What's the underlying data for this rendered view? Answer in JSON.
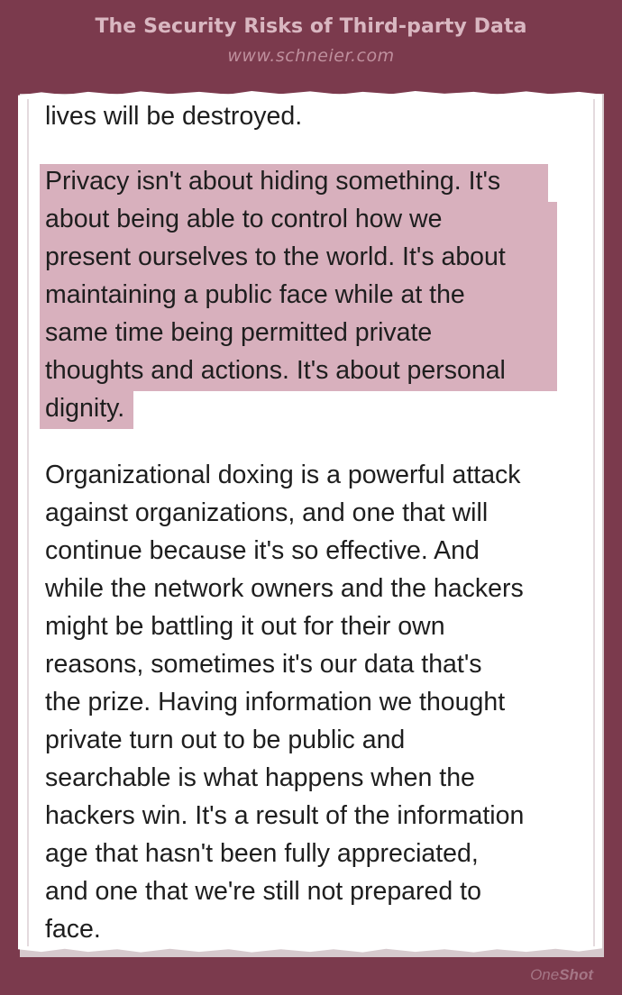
{
  "header": {
    "title": "The Security Risks of Third-party Data",
    "source": "www.schneier.com"
  },
  "article": {
    "lead_fragment": "lives will be destroyed.",
    "highlighted_lines": [
      "Privacy isn't about hiding something. It's",
      "about being able to control how we",
      "present ourselves to the world. It's about",
      "maintaining a public face while at the",
      "same time being permitted private",
      "thoughts and actions. It's about personal",
      "dignity."
    ],
    "paragraph_lines": [
      "Organizational doxing is a powerful attack",
      "against organizations, and one that will",
      "continue because it's so effective. And",
      "while the network owners and the hackers",
      "might be battling it out for their own",
      "reasons, sometimes it's our data that's",
      "the prize. Having information we thought",
      "private turn out to be public and",
      "searchable is what happens when the",
      "hackers win. It's a result of the information",
      "age that hasn't been fully appreciated,",
      "and one that we're still not prepared to",
      "face."
    ],
    "highlight_color": "#d8b0bd"
  },
  "footer": {
    "brand_light": "One",
    "brand_bold": "Shot"
  },
  "colors": {
    "background": "#7b3a4d",
    "card": "#ffffff",
    "title": "#d9b7c1",
    "text": "#1e1e1e"
  }
}
